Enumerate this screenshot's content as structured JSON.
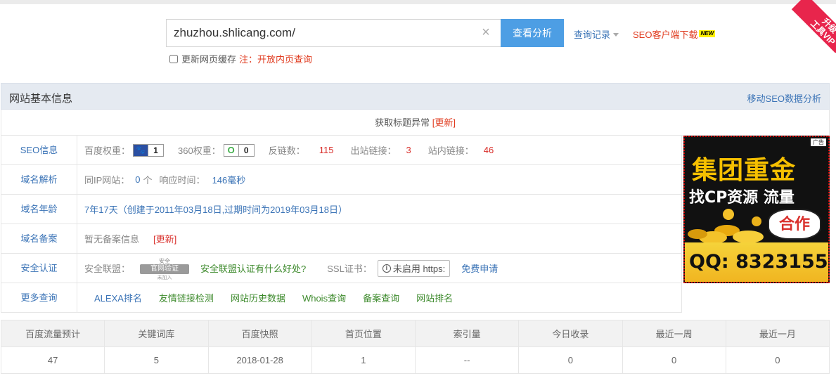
{
  "search": {
    "value": "zhuzhou.shlicang.com/",
    "button": "查看分析",
    "history": "查询记录",
    "seo_client": "SEO客户端下载",
    "new_badge": "NEW",
    "refresh_label": "更新网页缓存",
    "note_label": "注：",
    "note_link": "开放内页查询"
  },
  "vip": {
    "line1": "升级",
    "line2": "工具VIP"
  },
  "panel": {
    "title": "网站基本信息",
    "mobile_link": "移动SEO数据分析",
    "title_status": "获取标题异常",
    "title_update": "[更新]"
  },
  "rows": {
    "seo": {
      "label": "SEO信息",
      "baidu_label": "百度权重：",
      "baidu_value": "1",
      "r360_label": "360权重：",
      "r360_value": "0",
      "backlinks_label": "反链数：",
      "backlinks_value": "115",
      "outlinks_label": "出站链接：",
      "outlinks_value": "3",
      "inlinks_label": "站内链接：",
      "inlinks_value": "46"
    },
    "dns": {
      "label": "域名解析",
      "same_ip_label": "同IP网站：",
      "same_ip_value": "0",
      "same_ip_unit": "个",
      "response_label": "响应时间：",
      "response_value": "146毫秒"
    },
    "age": {
      "label": "域名年龄",
      "value": "7年17天（创建于2011年03月18日,过期时间为2019年03月18日）"
    },
    "icp": {
      "label": "域名备案",
      "value": "暂无备案信息",
      "update": "[更新]"
    },
    "security": {
      "label": "安全认证",
      "alliance_label": "安全联盟：",
      "seal_top": "安全",
      "seal_band": "官网验证",
      "seal_bottom": "未加入",
      "alliance_link": "安全联盟认证有什么好处?",
      "ssl_label": "SSL证书：",
      "ssl_value": "未启用 https:",
      "ssl_apply": "免费申请"
    },
    "more": {
      "label": "更多查询",
      "links": [
        "ALEXA排名",
        "友情链接检测",
        "网站历史数据",
        "Whois查询",
        "备案查询",
        "网站排名"
      ]
    }
  },
  "ad": {
    "tag": "广告",
    "line1": "集团重金",
    "line2": "找CP资源 流量",
    "cloud": "合作",
    "qq": "QQ: 8323155"
  },
  "stats": {
    "headers": [
      "百度流量预计",
      "关键词库",
      "百度快照",
      "首页位置",
      "索引量",
      "今日收录",
      "最近一周",
      "最近一月"
    ],
    "values": [
      "47",
      "5",
      "2018-01-28",
      "1",
      "--",
      "0",
      "0",
      "0"
    ]
  },
  "colors": {
    "accent": "#4d9ee4",
    "link": "#3a73b6",
    "red": "#d9302c",
    "green": "#3d8a2c",
    "ribbon": "#e8254c"
  }
}
